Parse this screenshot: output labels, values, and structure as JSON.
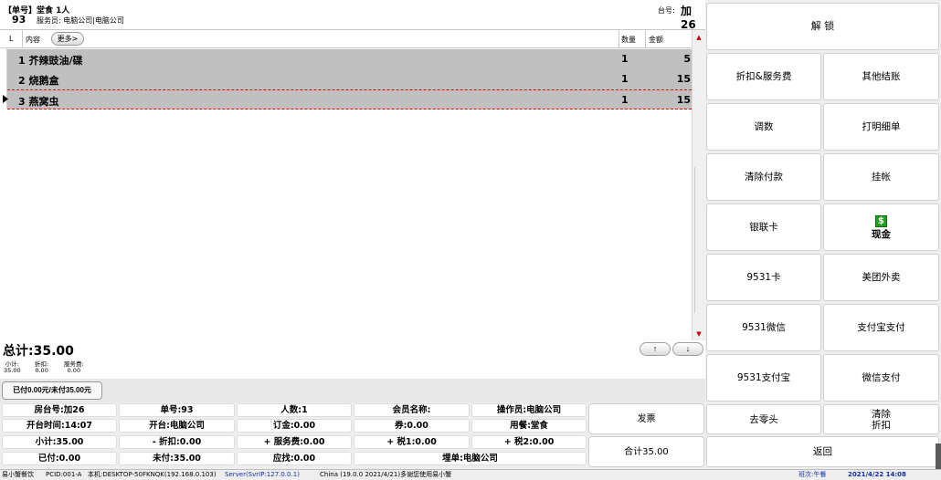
{
  "header": {
    "order_tag": "【单号】",
    "dine_type": "堂食 1人",
    "order_no": "93",
    "staff": "服务员: 电脑公司|电脑公司",
    "table_label": "台号:",
    "table_value": "加26"
  },
  "grid": {
    "columns": {
      "line": "L",
      "content": "内容",
      "more": "更多>",
      "qty": "数量",
      "amount": "金额"
    },
    "rows": [
      {
        "no": "1",
        "name": "芥辣豉油/碟",
        "qty": "1",
        "amount": "5"
      },
      {
        "no": "2",
        "name": "烧鹅盒",
        "qty": "1",
        "amount": "15"
      },
      {
        "no": "3",
        "name": "燕窝虫",
        "qty": "1",
        "amount": "15"
      }
    ],
    "selected_row": 3
  },
  "total": {
    "label": "总计:35.00",
    "up_arrow": "↑",
    "down_arrow": "↓"
  },
  "subtotals": [
    {
      "label": "小计:",
      "value": "35.00"
    },
    {
      "label": "折扣:",
      "value": "0.00"
    },
    {
      "label": "服务费:",
      "value": "0.00"
    }
  ],
  "paid_status": "已付0.00元/未付35.00元",
  "info": [
    [
      "房台号:加26",
      "单号:93",
      "人数:1",
      "会员名称:",
      "操作员:电脑公司"
    ],
    [
      "开台时间:14:07",
      "开台:电脑公司",
      "订金:0.00",
      "券:0.00",
      "用餐:堂食"
    ],
    [
      "小计:35.00",
      "- 折扣:0.00",
      "+ 服务费:0.00",
      "+ 税1:0.00",
      "+ 税2:0.00"
    ],
    [
      "已付:0.00",
      "未付:35.00",
      "应找:0.00",
      "埋单:电脑公司"
    ]
  ],
  "info_buttons": {
    "invoice": "发票",
    "sum": "合计35.00"
  },
  "right_panel": {
    "unlock": "解 锁",
    "buttons": [
      [
        "折扣&服务费",
        "其他结账"
      ],
      [
        "调数",
        "打明细单"
      ],
      [
        "清除付款",
        "挂帐"
      ],
      [
        "银联卡",
        "现金"
      ],
      [
        "9531卡",
        "美团外卖"
      ],
      [
        "9531微信",
        "支付宝支付"
      ],
      [
        "9531支付宝",
        "微信支付"
      ],
      [
        "去零头",
        "清除\n折扣"
      ]
    ],
    "back": "返回",
    "cash_icon": "dollar-icon",
    "cash_symbol": "$"
  },
  "status_bar": {
    "app": "易小蟹餐饮",
    "pcid": "PCID:001-A",
    "host": "本机:DESKTOP-50FKNQK(192.168.0.103)",
    "server": "Server(SvrIP:127.0.0.1)",
    "version": "China (19.0.0 2021/4/21)多谢您使用易小蟹",
    "shift": "班次:午餐",
    "datetime": "2021/4/22 14:08"
  }
}
